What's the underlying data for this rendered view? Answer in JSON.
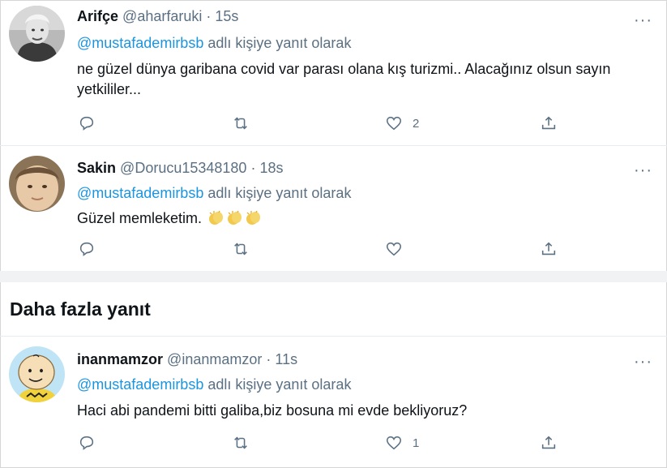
{
  "tweets": [
    {
      "display_name": "Arifçe",
      "handle": "@aharfaruki",
      "time": "15s",
      "reply_prefix": "@mustafademirbsb",
      "reply_suffix": "adlı kişiye yanıt olarak",
      "text": "ne güzel dünya garibana covid var parası olana kış turizmi.. Alacağınız olsun sayın yetkililer...",
      "likes": "2",
      "avatar": "bw-man-avatar"
    },
    {
      "display_name": "Sakin",
      "handle": "@Dorucu15348180",
      "time": "18s",
      "reply_prefix": "@mustafademirbsb",
      "reply_suffix": "adlı kişiye yanıt olarak",
      "text": "Güzel memleketim.",
      "emojis": [
        "clapping-hands-emoji",
        "clapping-hands-emoji",
        "clapping-hands-emoji"
      ],
      "likes": "",
      "avatar": "child-face-avatar"
    },
    {
      "display_name": "inanmamzor",
      "handle": "@inanmamzor",
      "time": "11s",
      "reply_prefix": "@mustafademirbsb",
      "reply_suffix": "adlı kişiye yanıt olarak",
      "text": "Haci abi pandemi bitti galiba,biz bosuna mi evde bekliyoruz?",
      "likes": "1",
      "avatar": "cartoon-boy-avatar"
    }
  ],
  "section": {
    "title": "Daha fazla yanıt"
  },
  "separator_dot": "·",
  "more_label": "···",
  "colors": {
    "link": "#1b95e0",
    "muted": "#5b7083",
    "text": "#0f1419",
    "divider_bg": "#f0f2f4"
  },
  "icons": [
    "reply-icon",
    "retweet-icon",
    "like-icon",
    "share-icon",
    "more-icon"
  ]
}
